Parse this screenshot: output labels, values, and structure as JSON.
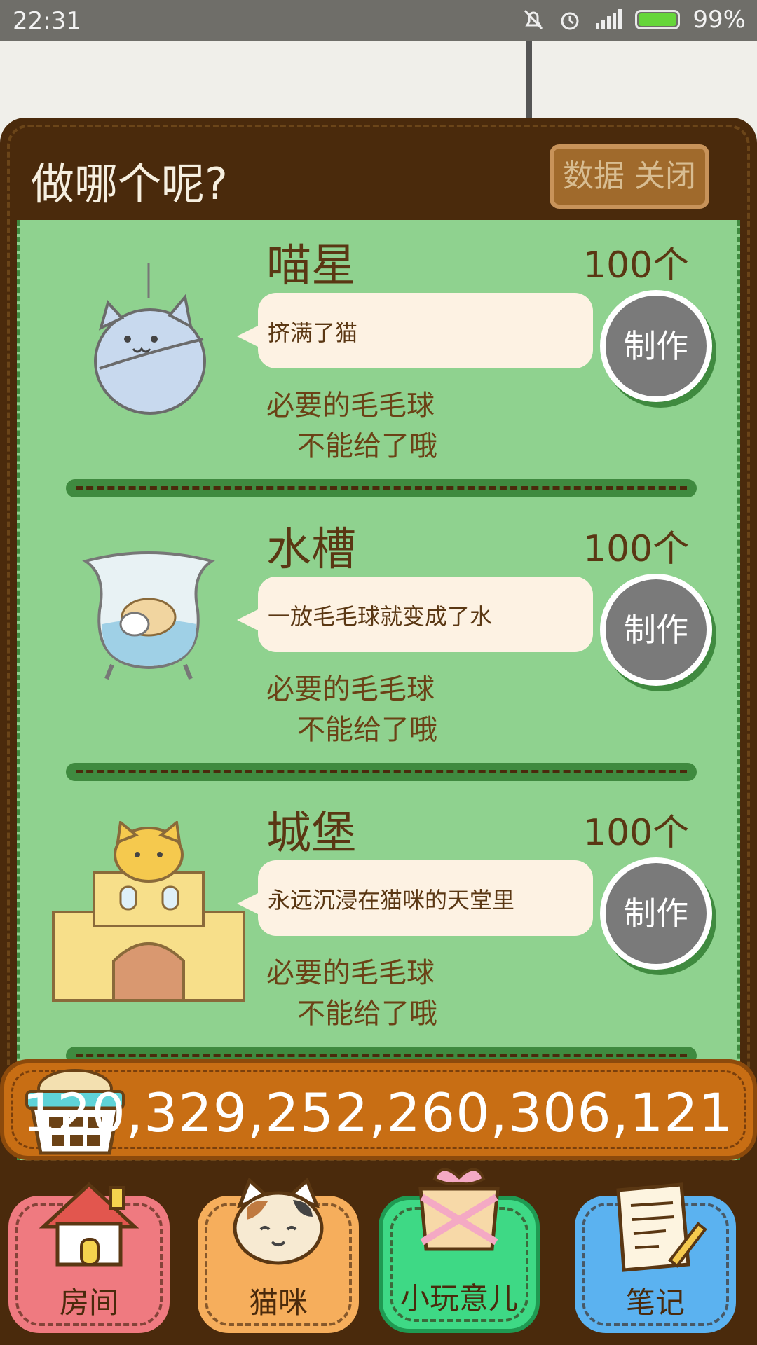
{
  "status_bar": {
    "time": "22:31",
    "battery": "99%"
  },
  "header": {
    "title": "做哪个呢?",
    "close_label": "数据 关闭"
  },
  "items": [
    {
      "name": "喵星",
      "count": "100个",
      "description": "挤满了猫",
      "requirement_line1": "必要的毛毛球",
      "requirement_line2": "不能给了哦",
      "make_label": "制作",
      "icon": "cat-planet-icon"
    },
    {
      "name": "水槽",
      "count": "100个",
      "description": "一放毛毛球就变成了水",
      "requirement_line1": "必要的毛毛球",
      "requirement_line2": "不能给了哦",
      "make_label": "制作",
      "icon": "fishbowl-icon"
    },
    {
      "name": "城堡",
      "count": "100个",
      "description": "永远沉浸在猫咪的天堂里",
      "requirement_line1": "必要的毛毛球",
      "requirement_line2": "不能给了哦",
      "make_label": "制作",
      "icon": "castle-icon"
    }
  ],
  "currency": {
    "value": "120,329,252,260,306,121",
    "icon": "yarn-basket-icon"
  },
  "tabs": [
    {
      "label": "房间",
      "icon": "house-icon",
      "color": "#ef7a80"
    },
    {
      "label": "猫咪",
      "icon": "cat-face-icon",
      "color": "#f6ae5c"
    },
    {
      "label": "小玩意儿",
      "icon": "gift-box-icon",
      "color": "#3ed985"
    },
    {
      "label": "笔记",
      "icon": "notebook-icon",
      "color": "#5bb2f0"
    }
  ]
}
